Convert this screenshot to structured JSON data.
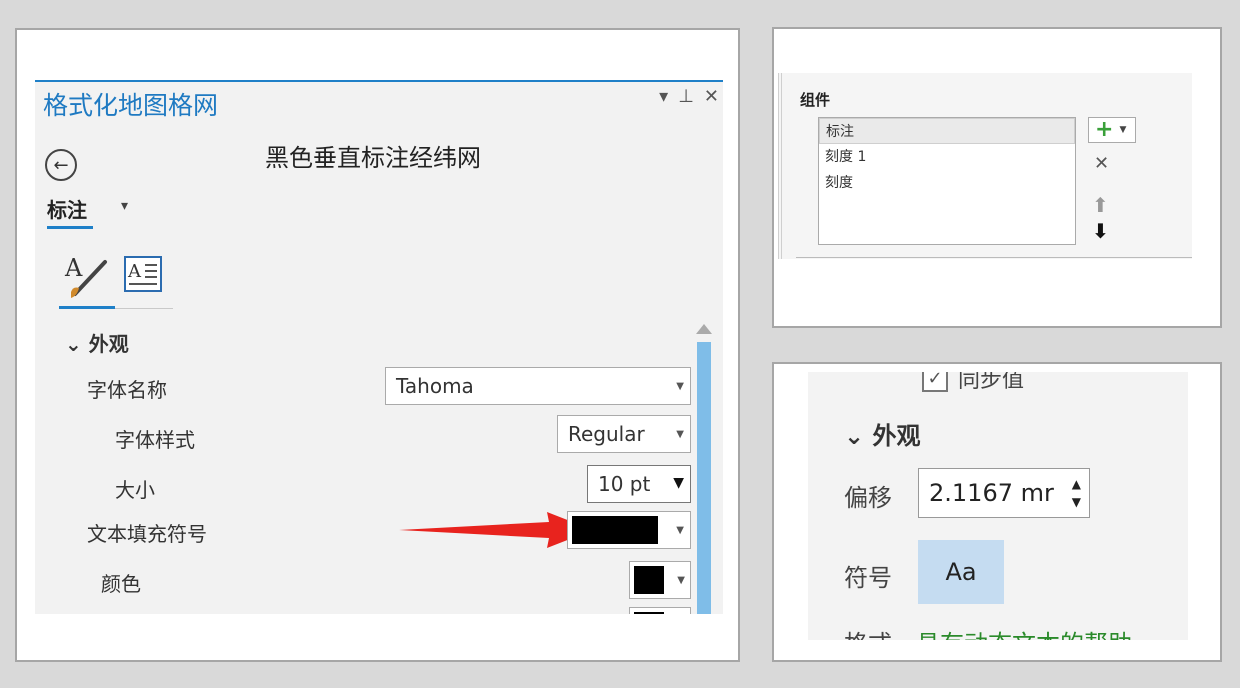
{
  "left_panel": {
    "title": "格式化地图格网",
    "controls": {
      "dropdown": "▾",
      "pin": "⊥",
      "close": "✕"
    },
    "back_symbol": "←",
    "subtitle": "黑色垂直标注经纬网",
    "tab_label": "标注",
    "tab_dropdown": "▾",
    "section_header": "外观",
    "fields": {
      "font_name_label": "字体名称",
      "font_name_value": "Tahoma",
      "font_style_label": "字体样式",
      "font_style_value": "Regular",
      "size_label": "大小",
      "size_value": "10 pt",
      "text_fill_label": "文本填充符号",
      "color_label": "颜色"
    },
    "colors": {
      "accent": "#1f80c8",
      "arrow": "#e8231e",
      "scrollbar": "#7fbde8",
      "swatch": "#000000"
    }
  },
  "components_panel": {
    "title": "组件",
    "items": [
      "标注",
      "刻度 1",
      "刻度"
    ],
    "selected_index": 0,
    "add_symbol": "+",
    "delete_symbol": "✕",
    "up_symbol": "⬆",
    "down_symbol": "⬇"
  },
  "appearance_panel": {
    "checkbox_label": "同步值",
    "checkbox_mark": "✓",
    "section_header": "外观",
    "offset_label": "偏移",
    "offset_value": "2.1167 mr",
    "symbol_label": "符号",
    "symbol_preview": "Aa",
    "format_label": "格式",
    "format_link": "具有动态文本的帮助"
  }
}
